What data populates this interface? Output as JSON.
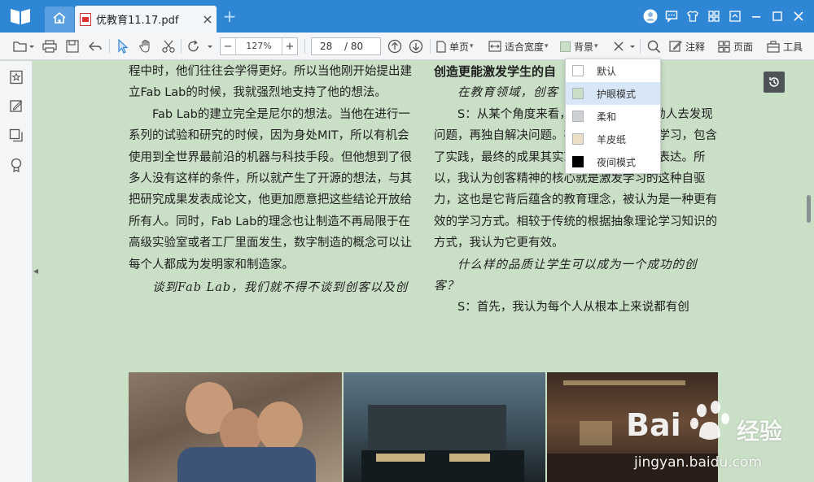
{
  "tabs": {
    "home_label": "",
    "document_name": "优教育11.17.pdf",
    "close_glyph": "×",
    "new_tab_glyph": "+"
  },
  "toolbar": {
    "zoom_minus": "−",
    "zoom_value": "127%",
    "zoom_plus": "+",
    "page_current": "28",
    "page_total": "/ 80",
    "single_page": "单页",
    "fit_width": "适合宽度",
    "background": "背景",
    "annotate": "注释",
    "page": "页面",
    "tools": "工具"
  },
  "background_menu": {
    "items": [
      {
        "label": "默认",
        "color": "#ffffff"
      },
      {
        "label": "护眼模式",
        "color": "#c9dfc6"
      },
      {
        "label": "柔和",
        "color": "#cfd0d3"
      },
      {
        "label": "羊皮纸",
        "color": "#eadfc6"
      },
      {
        "label": "夜间模式",
        "color": "#000000"
      }
    ],
    "selected_index": 1
  },
  "document": {
    "left_col": [
      {
        "text": "程中时，他们往往会学得更好。所以当他刚开始提出建立Fab Lab的时候，我就强烈地支持了他的想法。",
        "indent": false
      },
      {
        "text": "Fab Lab的建立完全是尼尔的想法。当他在进行一系列的试验和研究的时候，因为身处MIT，所以有机会使用到全世界最前沿的机器与科技手段。但他想到了很多人没有这样的条件，所以就产生了开源的想法，与其把研究成果发表成论文，他更加愿意把这些结论开放给所有人。同时，Fab Lab的理念也让制造不再局限于在高级实验室或者工厂里面发生，数字制造的概念可以让每个人都成为发明家和制造家。",
        "indent": true
      },
      {
        "text": "谈到Fab Lab，我们就不得不谈到创客以及创",
        "indent": true,
        "song": true
      }
    ],
    "right_heading": "创造更能激发学生的自",
    "right_col": [
      {
        "text": "在教育领域，创客",
        "indent": true,
        "song": true
      },
      {
        "text": "S：从某个角度来看，创客本质上是激励人去发现问题，再独自解决问题。在这其中，包含了学习，包含了实践，最终的成果其实就是一个人的最终表达。所以，我认为创客精神的核心就是激发学习的这种自驱力，这也是它背后蕴含的教育理念，被认为是一种更有效的学习方式。相较于传统的根据抽象理论学习知识的方式，我认为它更有效。",
        "indent": true
      },
      {
        "text": "什么样的品质让学生可以成为一个成功的创客？",
        "indent": true,
        "song": true
      },
      {
        "text": "S：首先，我认为每个人从根本上来说都有创",
        "indent": true
      }
    ]
  },
  "watermark": {
    "brand": "Bai",
    "brand2": "经验",
    "url": "jingyan.baidu.com"
  },
  "colors": {
    "titlebar": "#2f86d4",
    "page_bg": "#c9dfc6",
    "menu_selected": "#d7e7f7"
  }
}
